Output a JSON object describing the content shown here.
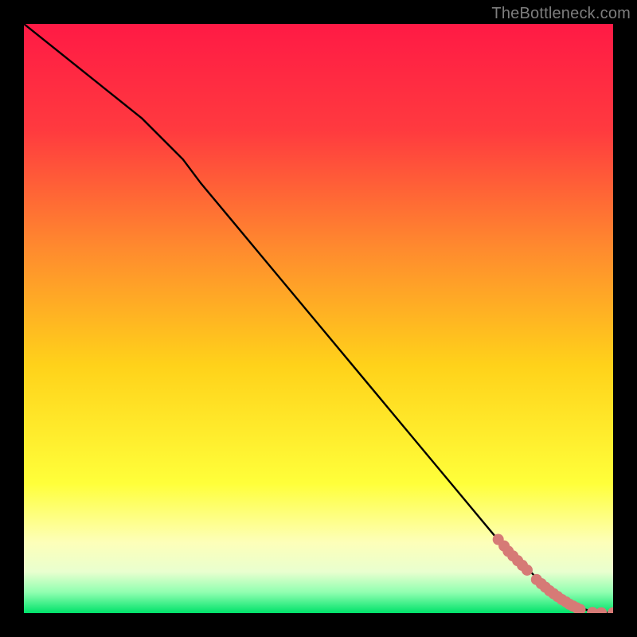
{
  "watermark": "TheBottleneck.com",
  "chart_data": {
    "type": "line",
    "title": "",
    "xlabel": "",
    "ylabel": "",
    "xlim": [
      0,
      100
    ],
    "ylim": [
      0,
      100
    ],
    "grid": false,
    "legend": false,
    "background_gradient_stops": [
      {
        "offset": 0.0,
        "color": "#ff1a45"
      },
      {
        "offset": 0.18,
        "color": "#ff3a3f"
      },
      {
        "offset": 0.38,
        "color": "#ff8a2e"
      },
      {
        "offset": 0.58,
        "color": "#ffd21a"
      },
      {
        "offset": 0.78,
        "color": "#ffff3a"
      },
      {
        "offset": 0.88,
        "color": "#fdffb9"
      },
      {
        "offset": 0.93,
        "color": "#e9ffcf"
      },
      {
        "offset": 0.965,
        "color": "#8fffb0"
      },
      {
        "offset": 1.0,
        "color": "#00e26a"
      }
    ],
    "series": [
      {
        "name": "curve",
        "kind": "line",
        "color": "#000000",
        "x": [
          0,
          5,
          10,
          15,
          20,
          25,
          27,
          30,
          35,
          40,
          45,
          50,
          55,
          60,
          65,
          70,
          75,
          80,
          85,
          88,
          90,
          92,
          93,
          94,
          95,
          96,
          98,
          100
        ],
        "y": [
          100,
          96,
          92,
          88,
          84,
          79,
          77,
          73,
          67,
          61,
          55,
          49,
          43,
          37,
          31,
          25,
          19,
          13,
          8,
          5,
          3.5,
          2.2,
          1.6,
          1.1,
          0.7,
          0.4,
          0.15,
          0
        ]
      },
      {
        "name": "points",
        "kind": "scatter",
        "color": "#d67a76",
        "radius": 7,
        "x": [
          80.5,
          81.5,
          82.2,
          83.0,
          83.8,
          84.6,
          85.4,
          87.0,
          87.8,
          88.5,
          89.2,
          89.9,
          90.6,
          91.3,
          92.0,
          92.6,
          93.2,
          93.8,
          94.4,
          96.5,
          98.0,
          100.0
        ],
        "y": [
          12.5,
          11.4,
          10.5,
          9.7,
          8.9,
          8.1,
          7.3,
          5.7,
          5.0,
          4.4,
          3.8,
          3.3,
          2.8,
          2.3,
          1.9,
          1.5,
          1.2,
          0.9,
          0.6,
          0.1,
          0.05,
          0.05
        ]
      }
    ]
  }
}
